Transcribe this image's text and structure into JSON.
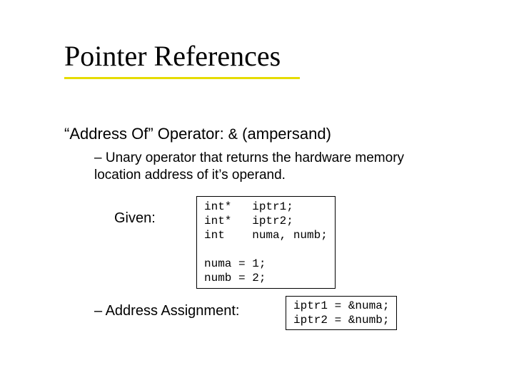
{
  "title": "Pointer References",
  "line1_prefix": "“Address Of” Operator:  ",
  "line1_amp": "&",
  "line1_suffix": "  (ampersand)",
  "bullet1": "– Unary operator that returns the hardware memory location address of it’s operand.",
  "given_label": "Given:",
  "code1": "int*   iptr1;\nint*   iptr2;\nint    numa, numb;\n\nnuma = 1;\nnumb = 2;",
  "bullet2": "– Address Assignment:",
  "code2": "iptr1 = &numa;\niptr2 = &numb;"
}
